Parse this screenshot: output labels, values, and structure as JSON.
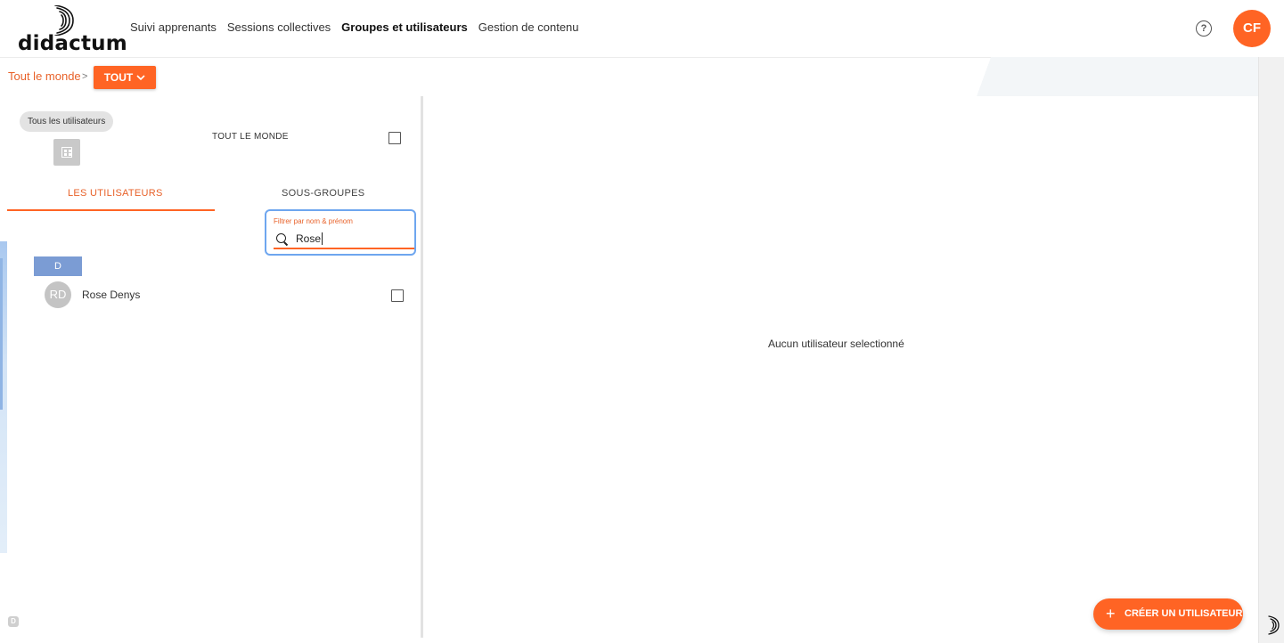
{
  "header": {
    "logo_text": "didactum",
    "nav": [
      {
        "label": "Suivi apprenants",
        "active": false
      },
      {
        "label": "Sessions collectives",
        "active": false
      },
      {
        "label": "Groupes et utilisateurs",
        "active": true
      },
      {
        "label": "Gestion de contenu",
        "active": false
      }
    ],
    "help_icon": "?",
    "user_initials": "CF",
    "accent_color": "#ff6424"
  },
  "breadcrumb": {
    "root": "Tout le monde",
    "separator": ">",
    "dropdown_label": "TOUT",
    "dropdown_icon": "chevron-down-icon"
  },
  "left_panel": {
    "chip": "Tous les utilisateurs",
    "group_icon": "building-icon",
    "group_name": "TOUT LE MONDE",
    "tabs": [
      {
        "label": "LES UTILISATEURS",
        "active": true
      },
      {
        "label": "SOUS-GROUPES",
        "active": false
      }
    ],
    "filter": {
      "label": "Filtrer par nom & prénom",
      "value": "Rose",
      "icon": "search-icon"
    },
    "groups": [
      {
        "letter": "D",
        "users": [
          {
            "initials": "RD",
            "name": "Rose Denys"
          }
        ]
      }
    ],
    "bottom_badge": "D"
  },
  "right_panel": {
    "empty_message": "Aucun utilisateur selectionné",
    "create_button_icon": "+",
    "create_button": "CRÉER UN UTILISATEUR"
  }
}
